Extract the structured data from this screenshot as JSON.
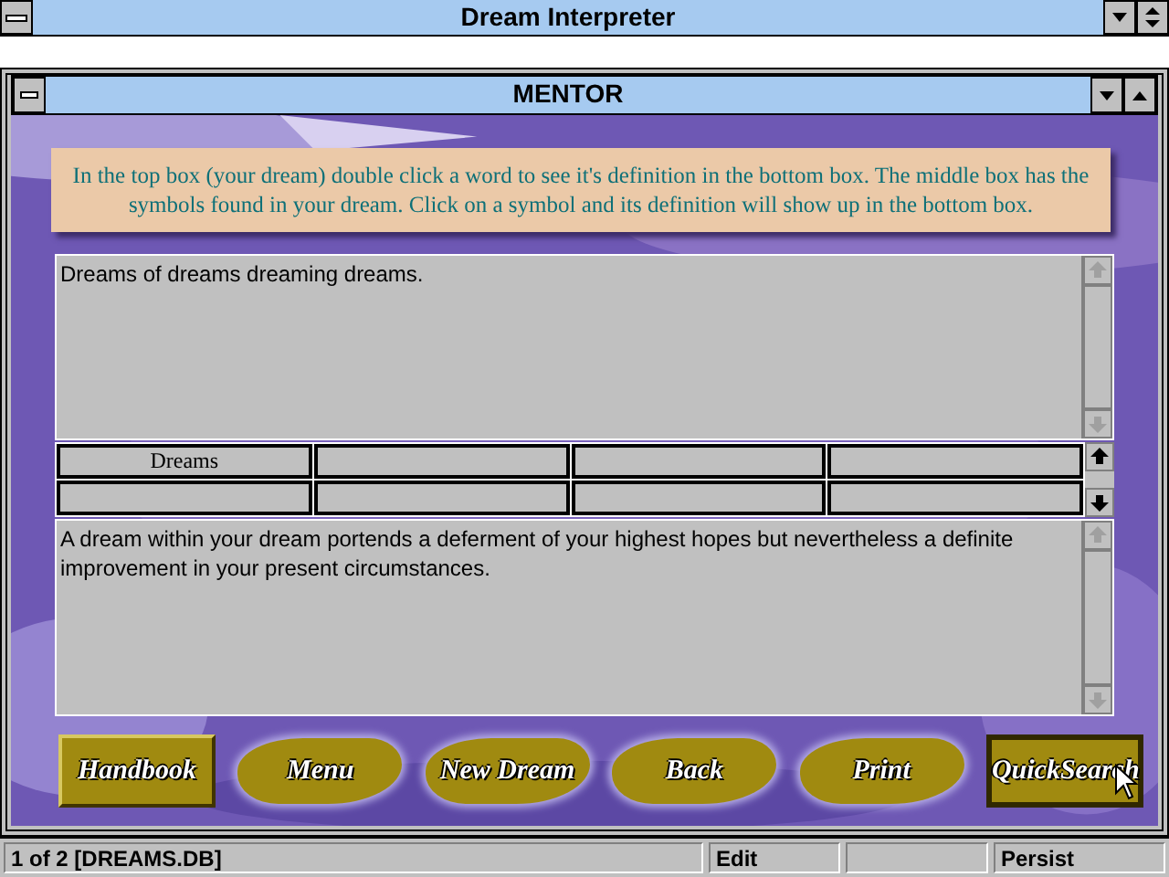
{
  "window": {
    "title": "Dream Interpreter"
  },
  "child_window": {
    "title": "MENTOR"
  },
  "instructions": "In the top box (your dream)  double click a word to see it's definition in the bottom box.  The middle box has the symbols found in your dream.  Click on a symbol and its definition will show up in the bottom box.",
  "dream_text": "Dreams of dreams dreaming dreams.",
  "symbols": [
    "Dreams"
  ],
  "definition": "A dream within your dream portends a deferment of your highest hopes but nevertheless a definite improvement in your present circumstances.",
  "buttons": [
    {
      "label": "Handbook",
      "kind": "plate",
      "selected": false
    },
    {
      "label": "Menu",
      "kind": "brush",
      "selected": false
    },
    {
      "label": "New Dream",
      "kind": "brush",
      "selected": false
    },
    {
      "label": "Back",
      "kind": "brush",
      "selected": false
    },
    {
      "label": "Print",
      "kind": "brush",
      "selected": false
    },
    {
      "label": "QuickSearch",
      "kind": "plate",
      "selected": true
    }
  ],
  "status_bar": {
    "record": "1 of 2 [DREAMS.DB]",
    "mode": "Edit",
    "option": "Persist"
  }
}
